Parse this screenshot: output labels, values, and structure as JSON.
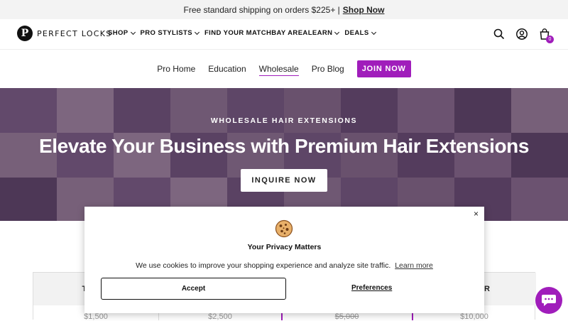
{
  "announcement": {
    "text": "Free standard shipping on orders $225+ |",
    "link": "Shop Now"
  },
  "header": {
    "logo_mark": "P",
    "logo_text": "PERFECT LOCKS",
    "nav": [
      {
        "label": "SHOP",
        "dropdown": true
      },
      {
        "label": "PRO STYLISTS",
        "dropdown": true
      },
      {
        "label": "FIND YOUR MATCH",
        "dropdown": false
      },
      {
        "label": "BAY AREA",
        "dropdown": false
      },
      {
        "label": "LEARN",
        "dropdown": true
      },
      {
        "label": "DEALS",
        "dropdown": true
      }
    ],
    "icons": [
      "search-icon",
      "account-icon",
      "cart-icon"
    ],
    "cart_count": "0"
  },
  "subnav": {
    "items": [
      "Pro Home",
      "Education",
      "Wholesale",
      "Pro Blog"
    ],
    "active": "Wholesale",
    "join_label": "JOIN NOW"
  },
  "hero": {
    "eyebrow": "WHOLESALE HAIR EXTENSIONS",
    "title": "Elevate Your Business with Premium Hair Extensions",
    "button": "INQUIRE NOW"
  },
  "pricing_table": {
    "columns": [
      {
        "heading": "THE R",
        "price": "$1,500",
        "strike": false
      },
      {
        "heading": "",
        "price": "$2,500",
        "strike": false
      },
      {
        "heading": "",
        "price": "$5,000",
        "strike": true
      },
      {
        "heading": "MAKER",
        "price": "$10,000",
        "strike": false
      }
    ]
  },
  "cookie_modal": {
    "close": "×",
    "title": "Your Privacy Matters",
    "text": "We use cookies to improve your shopping experience and analyze site traffic.",
    "learn_more": "Learn more",
    "accept": "Accept",
    "preferences": "Preferences"
  },
  "colors": {
    "accent": "#a01dbb",
    "announcement_bg": "#f3f3f3",
    "hero_overlay": "#5a3c64"
  }
}
